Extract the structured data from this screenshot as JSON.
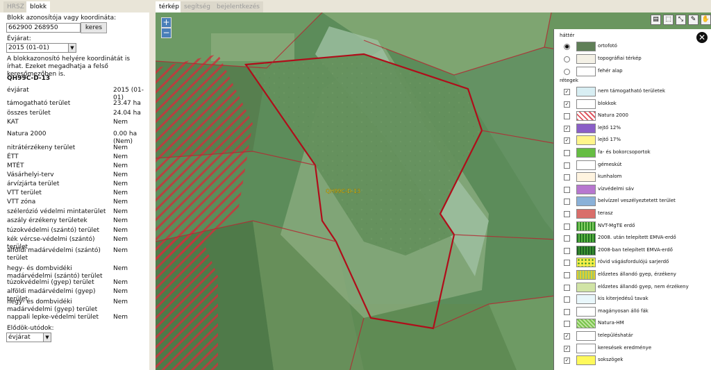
{
  "left_tabs": [
    {
      "label": "HRSZ"
    },
    {
      "label": "blokk"
    }
  ],
  "map_tabs": [
    {
      "label": "térkép"
    },
    {
      "label": "segítség"
    },
    {
      "label": "bejelentkezés"
    }
  ],
  "search": {
    "label": "Blokk azonosítója vagy koordináta:",
    "value": "662900 268950",
    "button": "keres"
  },
  "year": {
    "label": "Évjárat:",
    "value": "2015 (01-01)"
  },
  "info_text": "A blokkazonosító helyére koordinátát is írhat. Ezeket megadhatja a felső keresőmezőben is.",
  "block_id": "QH99C-D-13",
  "attributes": [
    {
      "k": "évjárat",
      "v": "2015 (01-01)"
    },
    {
      "k": "támogatható terület",
      "v": "23.47 ha"
    },
    {
      "k": "összes terület",
      "v": "24.04 ha"
    },
    {
      "k": "KAT",
      "v": "Nem"
    },
    {
      "k": "Natura 2000",
      "v": "0.00 ha (Nem)"
    },
    {
      "k": "nitrátérzékeny terület",
      "v": "Nem"
    },
    {
      "k": "ÉTT",
      "v": "Nem"
    },
    {
      "k": "MTÉT",
      "v": "Nem"
    },
    {
      "k": "Vásárhelyi-terv",
      "v": "Nem"
    },
    {
      "k": "árvízjárta terület",
      "v": "Nem"
    },
    {
      "k": "VTT terület",
      "v": "Nem"
    },
    {
      "k": "VTT zóna",
      "v": "Nem"
    },
    {
      "k": "szélerózió védelmi mintaterület",
      "v": "Nem"
    },
    {
      "k": "aszály érzékeny területek",
      "v": "Nem"
    },
    {
      "k": "túzokvédelmi (szántó) terület",
      "v": "Nem"
    },
    {
      "k": "kék vércse-védelmi (szántó) terület",
      "v": "Nem"
    },
    {
      "k": "alföldi madárvédelmi (szántó) terület",
      "v": "Nem"
    },
    {
      "k": "hegy- és dombvidéki madárvédelmi (szántó) terület",
      "v": "Nem"
    },
    {
      "k": "túzokvédelmi (gyep) terület",
      "v": "Nem"
    },
    {
      "k": "alföldi madárvédelmi (gyep) terület",
      "v": "Nem"
    },
    {
      "k": "hegy- és dombvidéki madárvédelmi (gyep) terület",
      "v": "Nem"
    },
    {
      "k": "nappali lepke-védelmi terület",
      "v": "Nem"
    }
  ],
  "predecessors": {
    "label": "Elődök-utódok:",
    "value": "évjárat"
  },
  "map": {
    "block_label": "QH99C-D-13",
    "zoom_in": "+",
    "zoom_out": "−"
  },
  "legend": {
    "background_header": "háttér",
    "layers_header": "rétegek",
    "backgrounds": [
      {
        "label": "ortofotó",
        "selected": true,
        "swatch": "photo"
      },
      {
        "label": "topográfiai térkép",
        "selected": false,
        "swatch": "topo"
      },
      {
        "label": "fehér alap",
        "selected": false,
        "swatch": "white"
      }
    ],
    "layers": [
      {
        "label": "nem támogatható területek",
        "checked": true,
        "swatch": "lightblue"
      },
      {
        "label": "blokkok",
        "checked": true,
        "swatch": "blokk"
      },
      {
        "label": "Natura 2000",
        "checked": false,
        "swatch": "natura"
      },
      {
        "label": "lejtő 12%",
        "checked": true,
        "swatch": "slope12"
      },
      {
        "label": "lejtő 17%",
        "checked": true,
        "swatch": "slope17"
      },
      {
        "label": "fa- és bokorcsoportok",
        "checked": false,
        "swatch": "tree"
      },
      {
        "label": "gémeskút",
        "checked": false,
        "swatch": "well"
      },
      {
        "label": "kunhalom",
        "checked": false,
        "swatch": "mound"
      },
      {
        "label": "vízvédelmi sáv",
        "checked": false,
        "swatch": "water"
      },
      {
        "label": "belvízzel veszélyeztetett terület",
        "checked": false,
        "swatch": "inland"
      },
      {
        "label": "terasz",
        "checked": false,
        "swatch": "terrace"
      },
      {
        "label": "NVT-MgTE erdő",
        "checked": false,
        "swatch": "forest1"
      },
      {
        "label": "2008. után telepített EMVA-erdő",
        "checked": false,
        "swatch": "forest2"
      },
      {
        "label": "2008-ban telepített EMVA-erdő",
        "checked": false,
        "swatch": "forest3"
      },
      {
        "label": "rövid vágásfordulójú sarjerdő",
        "checked": false,
        "swatch": "coppice"
      },
      {
        "label": "előzetes állandó gyep, érzékeny",
        "checked": false,
        "swatch": "grass1"
      },
      {
        "label": "előzetes állandó gyep, nem érzékeny",
        "checked": false,
        "swatch": "grass2"
      },
      {
        "label": "kis kiterjedésű tavak",
        "checked": false,
        "swatch": "lake"
      },
      {
        "label": "magányosan álló fák",
        "checked": false,
        "swatch": "lonetree"
      },
      {
        "label": "Natura-HM",
        "checked": false,
        "swatch": "naturahm"
      },
      {
        "label": "településhatár",
        "checked": true,
        "swatch": "border"
      },
      {
        "label": "keresések eredménye",
        "checked": true,
        "swatch": "result"
      },
      {
        "label": "sokszögek",
        "checked": true,
        "swatch": "polygon"
      }
    ]
  }
}
